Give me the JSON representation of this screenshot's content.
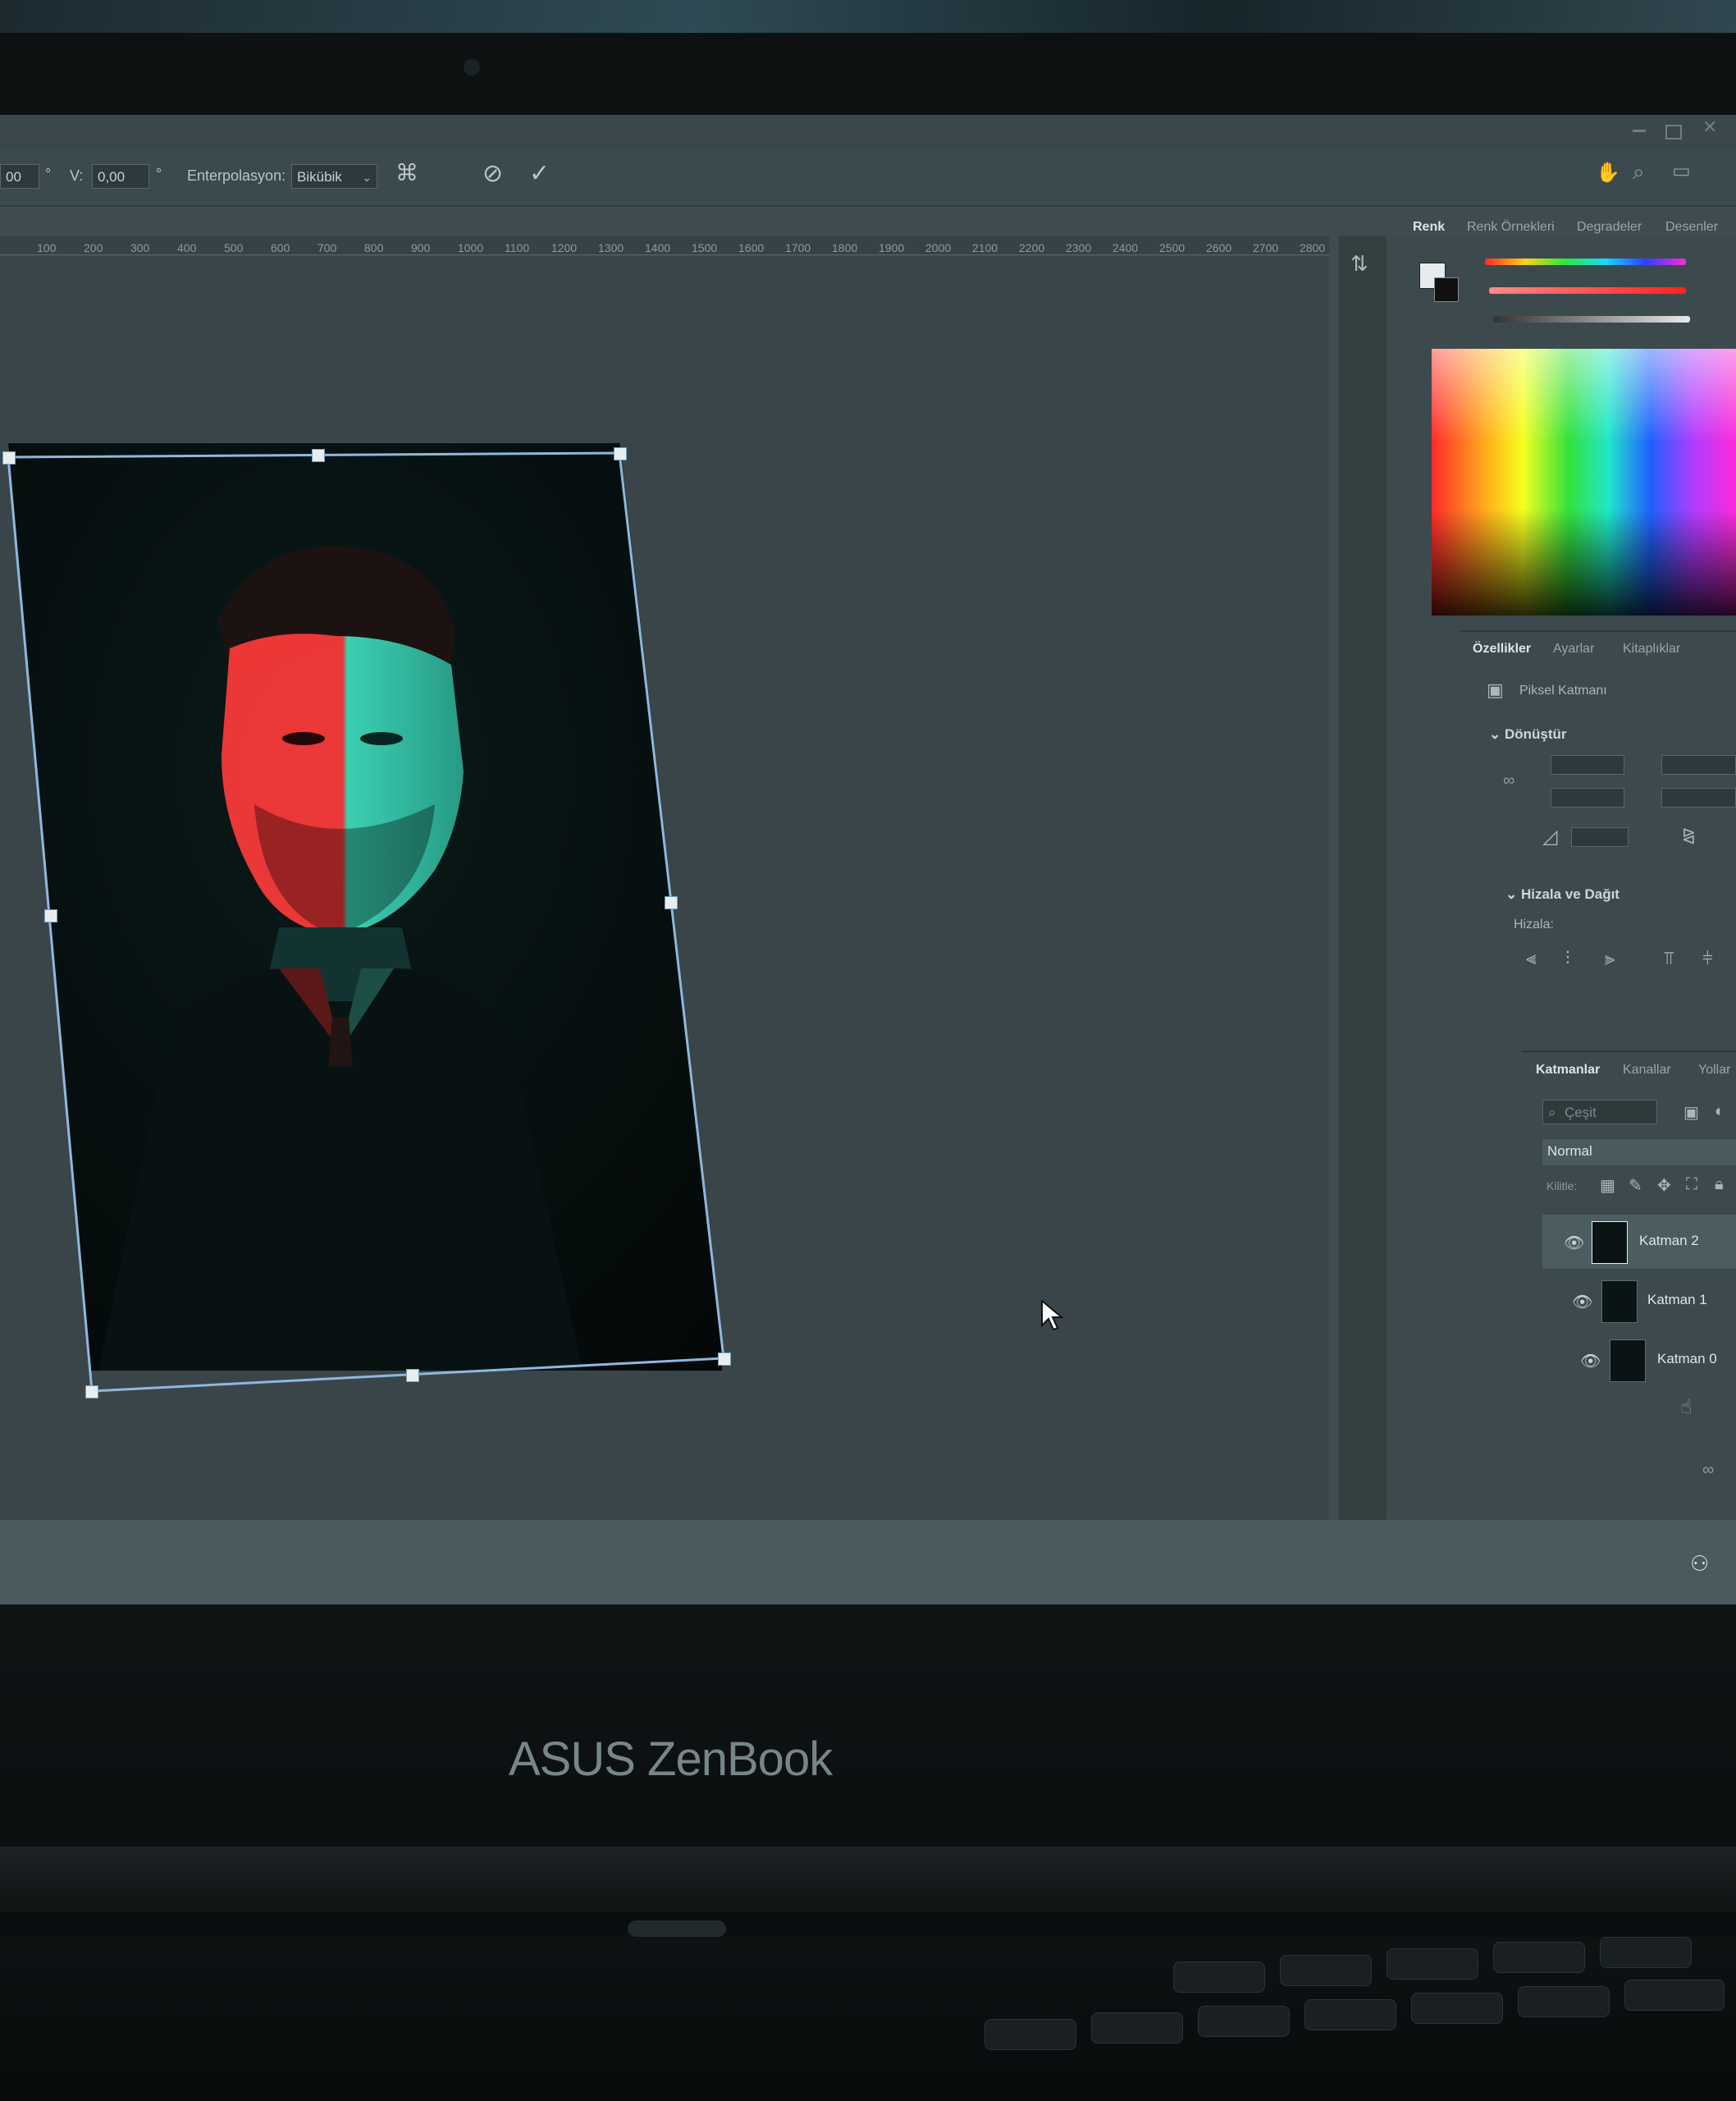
{
  "laptop": {
    "brand": "ASUS ZenBook"
  },
  "options_bar": {
    "w_value": "00",
    "w_unit": "°",
    "v_label": "V:",
    "v_value": "0,00",
    "v_unit": "°",
    "interpolation_label": "Enterpolasyon:",
    "interpolation_value": "Bikübik",
    "cancel_icon": "⊘",
    "commit_icon": "✓",
    "warp_icon": "⌘"
  },
  "ruler": {
    "ticks": [
      "100",
      "200",
      "300",
      "400",
      "500",
      "600",
      "700",
      "800",
      "900",
      "1000",
      "1100",
      "1200",
      "1300",
      "1400",
      "1500",
      "1600",
      "1700",
      "1800",
      "1900",
      "2000",
      "2100",
      "2200",
      "2300",
      "2400",
      "2500",
      "2600",
      "2700",
      "2800"
    ]
  },
  "color_panel": {
    "tabs": [
      "Renk",
      "Renk Örnekleri",
      "Degradeler",
      "Desenler"
    ],
    "active_tab": "Renk"
  },
  "properties_panel": {
    "tabs": [
      "Özellikler",
      "Ayarlar",
      "Kitaplıklar"
    ],
    "active_tab": "Özellikler",
    "layer_type": "Piksel Katmanı",
    "transform_section": "Dönüştür",
    "align_section": "Hizala ve Dağıt",
    "align_label": "Hizala:"
  },
  "layers_panel": {
    "tabs": [
      "Katmanlar",
      "Kanallar",
      "Yollar"
    ],
    "active_tab": "Katmanlar",
    "search_placeholder": "Çeşit",
    "blend_mode": "Normal",
    "lock_label": "Kilitle:",
    "layers": [
      {
        "name": "Katman 2",
        "selected": true
      },
      {
        "name": "Katman 1",
        "selected": false
      },
      {
        "name": "Katman 0",
        "selected": false
      }
    ]
  },
  "colors": {
    "screen_bg": "#3e4c51",
    "transform_border": "#8fb8df",
    "photo_red": "#ff3a3a",
    "photo_teal": "#3fe0c0"
  }
}
